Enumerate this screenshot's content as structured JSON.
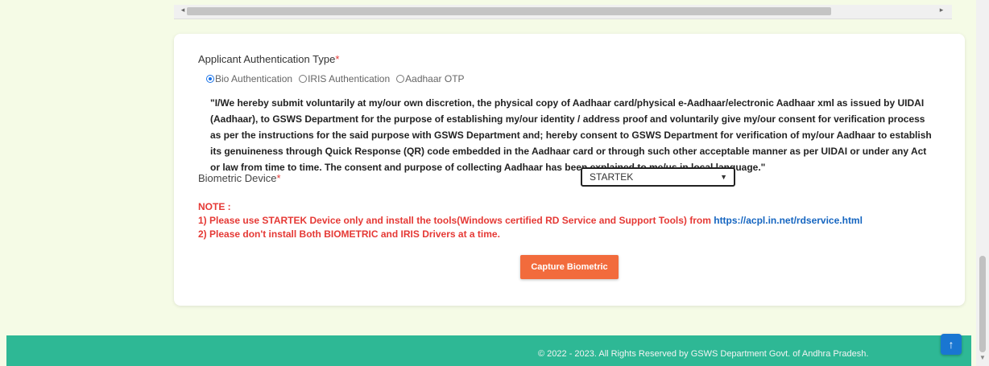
{
  "form": {
    "auth_type_label": "Applicant Authentication Type",
    "required_mark": "*",
    "auth_options": [
      {
        "label": "Bio Authentication",
        "selected": true
      },
      {
        "label": "IRIS Authentication",
        "selected": false
      },
      {
        "label": "Aadhaar OTP",
        "selected": false
      }
    ],
    "consent_text": "\"I/We hereby submit voluntarily at my/our own discretion, the physical copy of Aadhaar card/physical e-Aadhaar/electronic Aadhaar xml as issued by UIDAI (Aadhaar), to GSWS Department for the purpose of establishing my/our identity / address proof and voluntarily give my/our consent for verification process as per the instructions for the said purpose with GSWS Department and; hereby consent to GSWS Department for verification of my/our Aadhaar to establish its genuineness through Quick Response (QR) code embedded in the Aadhaar card or through such other acceptable manner as per UIDAI or under any Act or law from time to time. The consent and purpose of collecting Aadhaar has been explained to me/us in local language.\"",
    "biometric_device_label": "Biometric Device",
    "biometric_device_value": "STARTEK",
    "note_title": "NOTE :",
    "note_line1": "1) Please use STARTEK Device only and install the tools(Windows certified RD Service and Support Tools) from ",
    "note_link": "https://acpl.in.net/rdservice.html",
    "note_line2": "2) Please don't install Both BIOMETRIC and IRIS Drivers at a time.",
    "capture_button": "Capture Biometric"
  },
  "footer": {
    "copyright": "© 2022 - 2023. All Rights Reserved by GSWS Department Govt. of Andhra Pradesh."
  },
  "colors": {
    "accent_orange": "#f26b3c",
    "footer_green": "#2eb895",
    "required_red": "#e53935",
    "link_blue": "#1565c0"
  },
  "icons": {
    "scroll_left": "◂",
    "scroll_right": "▸",
    "select_chevron": "⌄",
    "back_to_top": "↑"
  }
}
